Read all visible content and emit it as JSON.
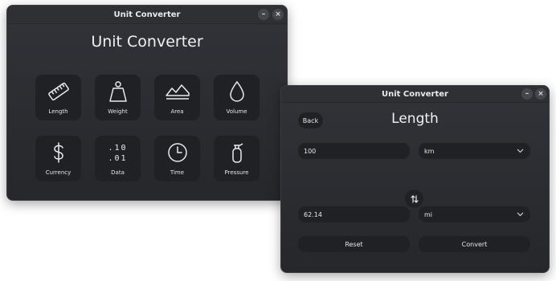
{
  "main_window": {
    "title": "Unit Converter",
    "heading": "Unit Converter",
    "controls": {
      "minimize": "–",
      "close": "×"
    },
    "categories": [
      {
        "label": "Length",
        "icon": "ruler-icon"
      },
      {
        "label": "Weight",
        "icon": "weight-icon"
      },
      {
        "label": "Area",
        "icon": "area-chart-icon"
      },
      {
        "label": "Volume",
        "icon": "droplet-icon"
      },
      {
        "label": "Currency",
        "icon": "dollar-icon"
      },
      {
        "label": "Data",
        "icon": "binary-icon",
        "glyph": ".10\n.01"
      },
      {
        "label": "Time",
        "icon": "clock-icon"
      },
      {
        "label": "Pressure",
        "icon": "gas-cylinder-icon"
      }
    ]
  },
  "length_window": {
    "title": "Unit Converter",
    "controls": {
      "minimize": "–",
      "close": "×"
    },
    "back_label": "Back",
    "heading": "Length",
    "from": {
      "value": "100",
      "unit": "km"
    },
    "to": {
      "value": "62.14",
      "unit": "mi"
    },
    "swap_icon": "swap-vertical-icon",
    "reset_label": "Reset",
    "convert_label": "Convert"
  }
}
